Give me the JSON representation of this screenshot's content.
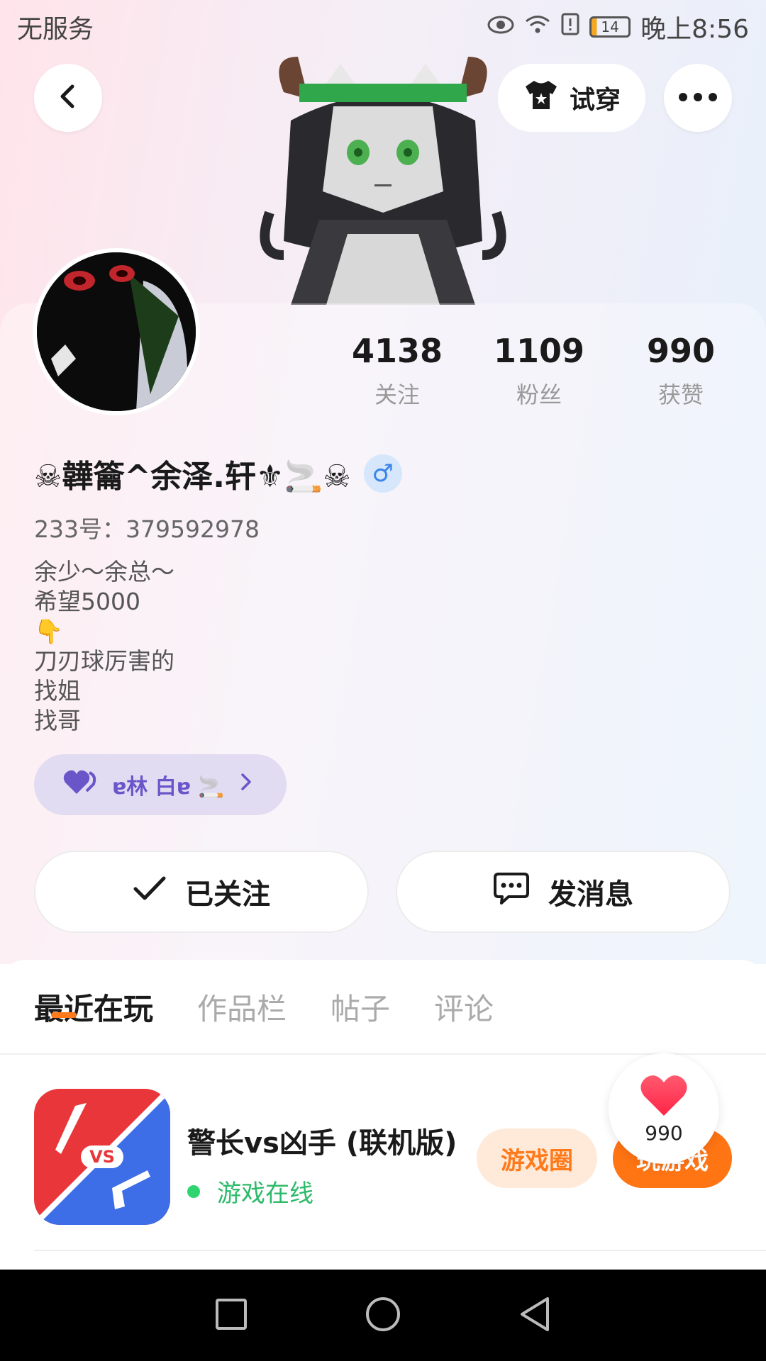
{
  "status_bar": {
    "carrier": "无服务",
    "battery": "14",
    "time": "晚上8:56"
  },
  "header": {
    "try_on_label": "试穿"
  },
  "profile": {
    "stats": [
      {
        "value": "4138",
        "label": "关注"
      },
      {
        "value": "1109",
        "label": "粉丝"
      },
      {
        "value": "990",
        "label": "获赞"
      }
    ],
    "username": "☠韡籥^余泽.轩⚜🚬☠",
    "gender_symbol": "♂",
    "user_id": "233号：379592978",
    "bio_lines": [
      "余少～余总～",
      "希望5000",
      "👇",
      "刀刃球厉害的",
      "找姐",
      "找哥"
    ],
    "cp_label": "ɐ林 白ɐ 🚬"
  },
  "actions": {
    "follow_label": "已关注",
    "message_label": "发消息"
  },
  "tabs": [
    "最近在玩",
    "作品栏",
    "帖子",
    "评论"
  ],
  "recent_game": {
    "name": "警长vs凶手 (联机版)",
    "status": "游戏在线",
    "icon_text": "VS",
    "circle_label": "游戏圈",
    "play_label": "玩游戏"
  },
  "like_float": {
    "count": "990"
  },
  "colors": {
    "accent": "#ff7413",
    "online": "#2dba6a",
    "gender": "#3a86e8",
    "cp_pill": "#e2dcf3"
  }
}
